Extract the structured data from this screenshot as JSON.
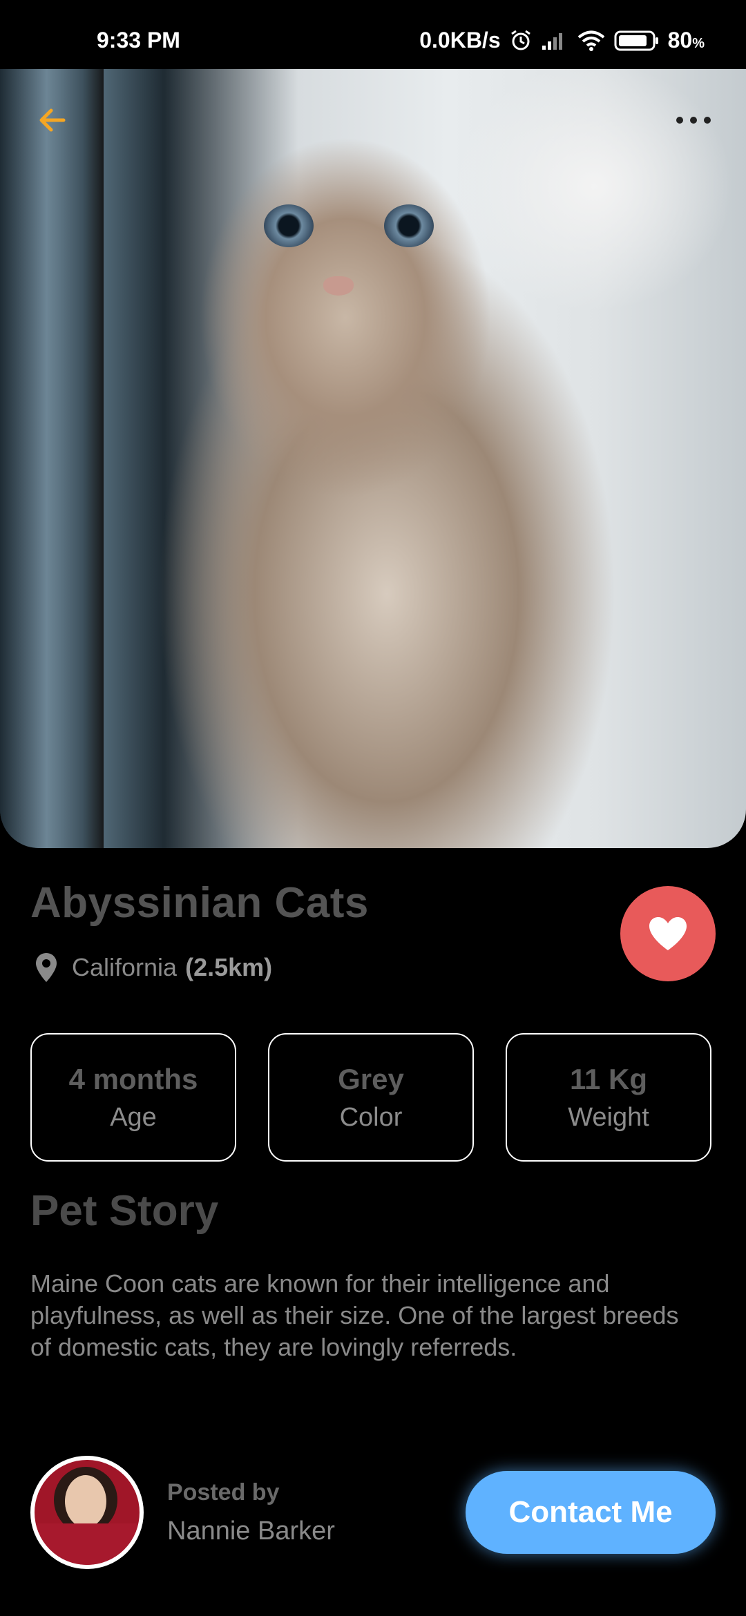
{
  "status_bar": {
    "time": "9:33 PM",
    "network_speed": "0.0KB/s",
    "battery_percent": "80",
    "battery_unit": "%"
  },
  "header": {
    "back_icon": "arrow-left-icon",
    "more_icon": "more-horizontal-icon",
    "accent_color": "#F5A623"
  },
  "pet": {
    "name": "Abyssinian Cats",
    "location": "California",
    "distance": "(2.5km)",
    "favorite_color": "#E85A5A",
    "stats": [
      {
        "value": "4 months",
        "label": "Age"
      },
      {
        "value": "Grey",
        "label": "Color"
      },
      {
        "value": "11 Kg",
        "label": "Weight"
      }
    ]
  },
  "story": {
    "title": "Pet Story",
    "text": "Maine Coon cats are known for their intelligence and playfulness, as well as their size. One of the largest breeds of domestic cats, they are lovingly referreds."
  },
  "poster": {
    "label": "Posted by",
    "name": "Nannie Barker"
  },
  "actions": {
    "contact_label": "Contact Me",
    "contact_color": "#5FB2FF"
  }
}
